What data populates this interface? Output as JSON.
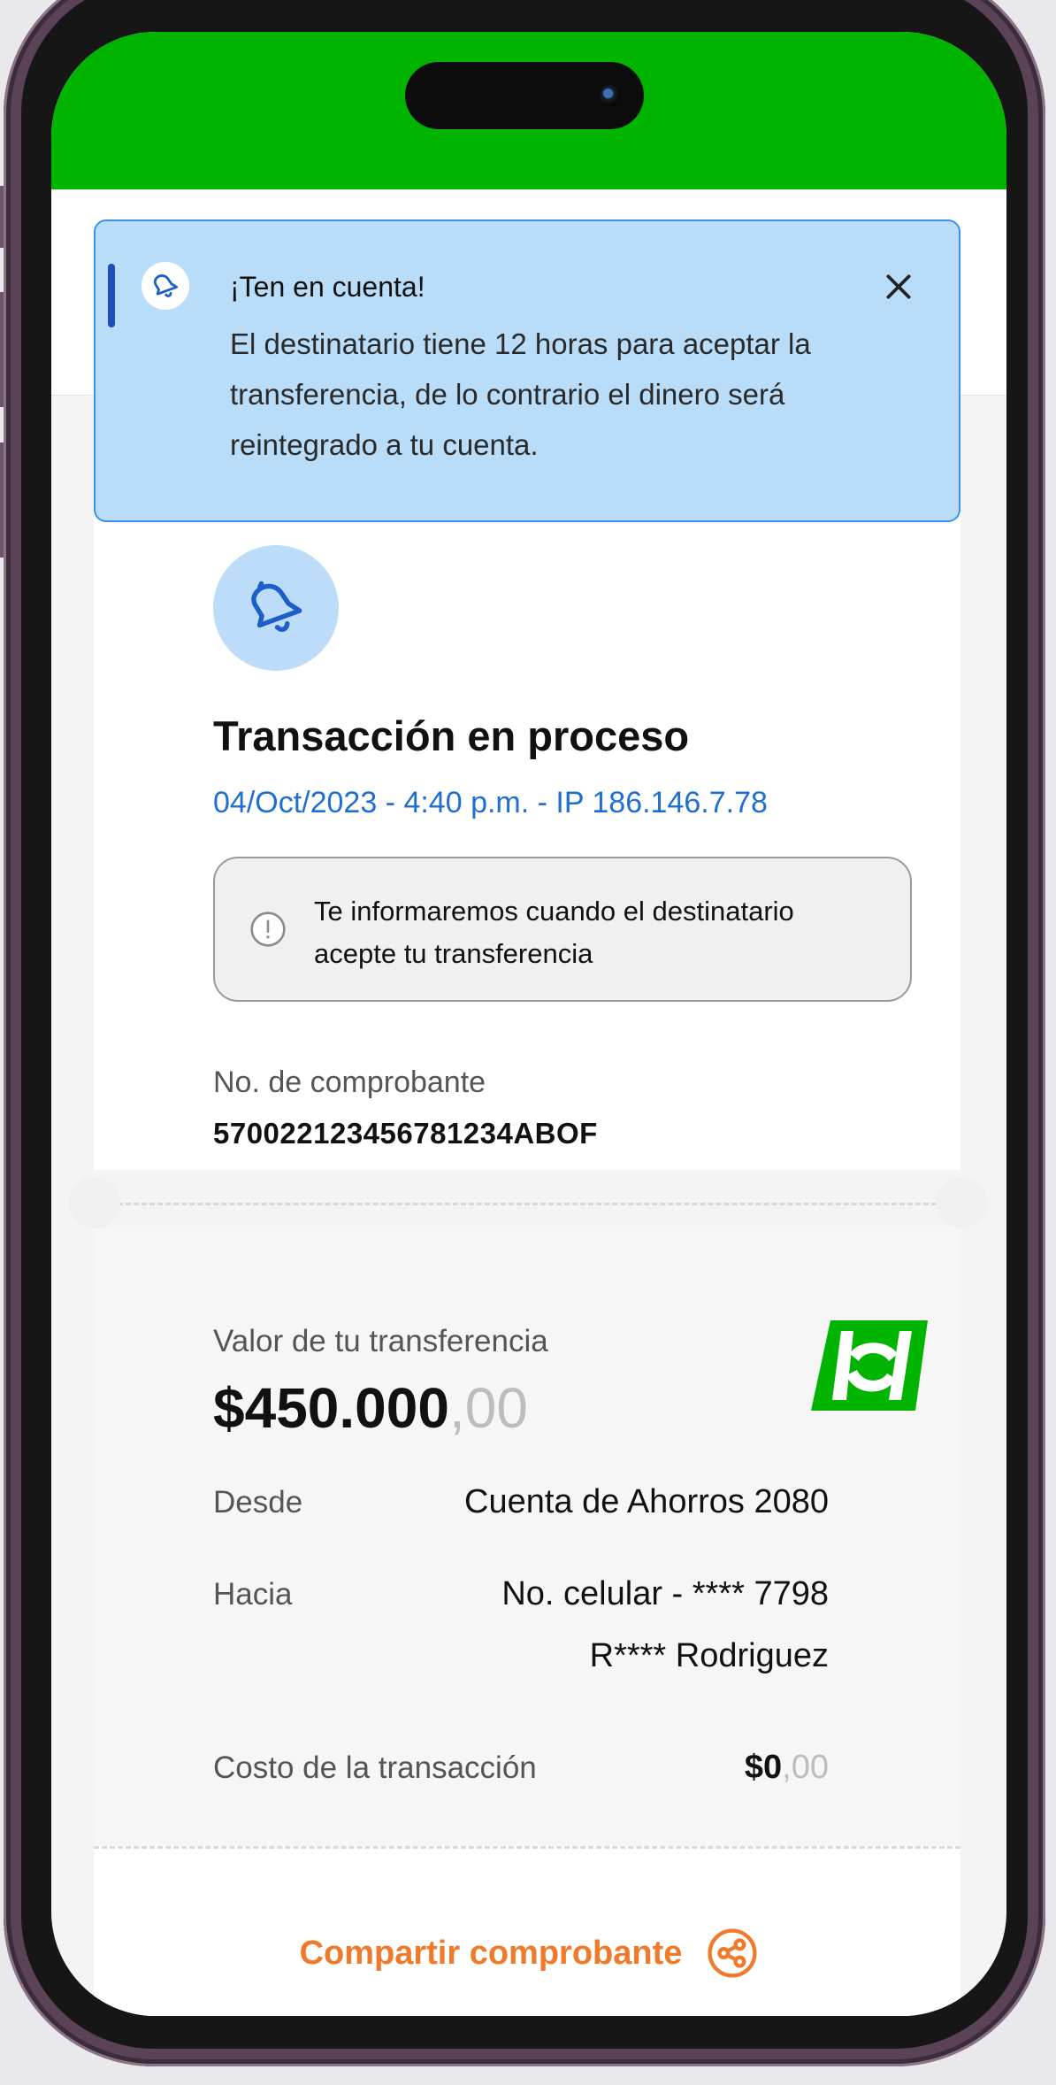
{
  "colors": {
    "brand_green": "#00b400",
    "info_blue": "#b9dcf9",
    "link_blue": "#1f6fd0",
    "accent_orange": "#f07a2a"
  },
  "toast": {
    "icon": "bell-icon",
    "title": "¡Ten en cuenta!",
    "body": "El destinatario tiene 12 horas para aceptar la transferencia, de lo contrario el dinero será reintegrado a tu cuenta.",
    "close_icon": "close-icon"
  },
  "transaction": {
    "status_icon": "bell-icon",
    "title": "Transacción en proceso",
    "meta": "04/Oct/2023 - 4:40 p.m. - IP 186.146.7.78",
    "info_icon": "alert-circle-icon",
    "info": "Te informaremos cuando el destinatario acepte tu transferencia",
    "receipt_label": "No. de comprobante",
    "receipt_value": "570022123456781234ABOF"
  },
  "amount": {
    "label": "Valor de tu transferencia",
    "whole": "$450.000",
    "decimals": ",00",
    "logo_icon": "bank-logo-icon"
  },
  "details": {
    "from_label": "Desde",
    "from_value": "Cuenta de Ahorros 2080",
    "to_label": "Hacia",
    "to_value_line1": "No. celular - **** 7798",
    "to_value_line2": "R**** Rodriguez",
    "cost_label": "Costo de la transacción",
    "cost_whole": "$0",
    "cost_decimals": ",00"
  },
  "share": {
    "label": "Compartir comprobante",
    "icon": "share-icon"
  }
}
